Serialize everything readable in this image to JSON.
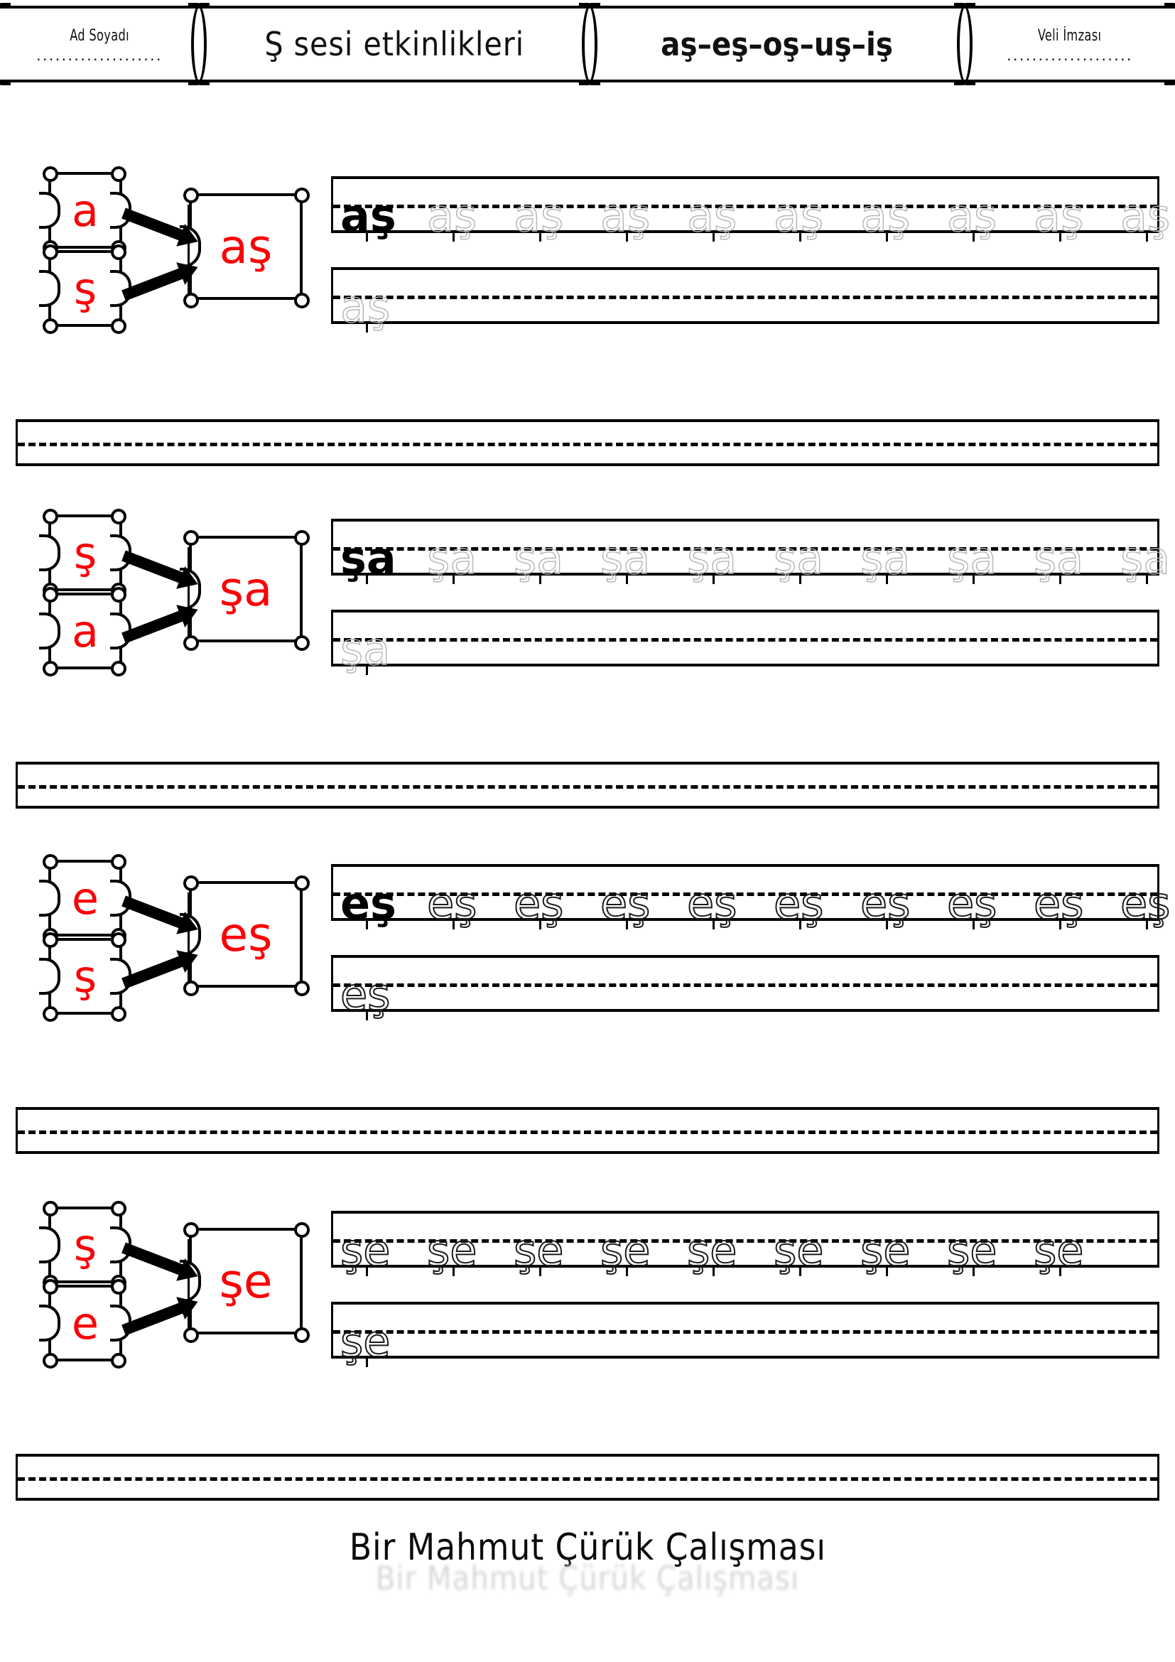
{
  "header": {
    "name_label": "Ad Soyadı",
    "name_dots": "....................",
    "title": "Ş sesi etkinlikleri",
    "syllables": "aş–eş–oş–uş–iş",
    "signature_label": "Veli İmzası",
    "signature_dots": "...................."
  },
  "colors": {
    "letter_red": "#fb0007",
    "ink_black": "#000000",
    "trace_gray": "#b4b4b4",
    "ghost_gray": "#d8d8d8"
  },
  "rows": [
    {
      "piece_top": "a",
      "piece_bottom": "ş",
      "piece_result": "aş",
      "line1": {
        "solid": "aş",
        "traces": [
          "aş",
          "aş",
          "aş",
          "aş",
          "aş",
          "aş",
          "aş",
          "aş",
          "aş"
        ],
        "trace_style": "gray"
      },
      "line2": {
        "solid": "",
        "traces": [
          "aş"
        ],
        "trace_style": "gray"
      }
    },
    {
      "piece_top": "ş",
      "piece_bottom": "a",
      "piece_result": "şa",
      "line1": {
        "solid": "şa",
        "traces": [
          "şa",
          "şa",
          "şa",
          "şa",
          "şa",
          "şa",
          "şa",
          "şa",
          "şa"
        ],
        "trace_style": "gray"
      },
      "line2": {
        "solid": "",
        "traces": [
          "şa"
        ],
        "trace_style": "gray"
      }
    },
    {
      "piece_top": "e",
      "piece_bottom": "ş",
      "piece_result": "eş",
      "line1": {
        "solid": "eş",
        "traces": [
          "eş",
          "eş",
          "eş",
          "eş",
          "eş",
          "eş",
          "eş",
          "eş",
          "eş"
        ],
        "trace_style": "dotted"
      },
      "line2": {
        "solid": "",
        "traces": [
          "eş"
        ],
        "trace_style": "dotted"
      }
    },
    {
      "piece_top": "ş",
      "piece_bottom": "e",
      "piece_result": "şe",
      "line1": {
        "solid": "",
        "traces": [
          "şe",
          "şe",
          "şe",
          "şe",
          "şe",
          "şe",
          "şe",
          "şe",
          "şe"
        ],
        "trace_style": "dotted"
      },
      "line2": {
        "solid": "",
        "traces": [
          "şe"
        ],
        "trace_style": "dotted"
      }
    }
  ],
  "separator_lines": 4,
  "footer": {
    "text": "Bir Mahmut Çürük Çalışması",
    "ghost_text": "Bir Mahmut Çürük Çalışması"
  }
}
